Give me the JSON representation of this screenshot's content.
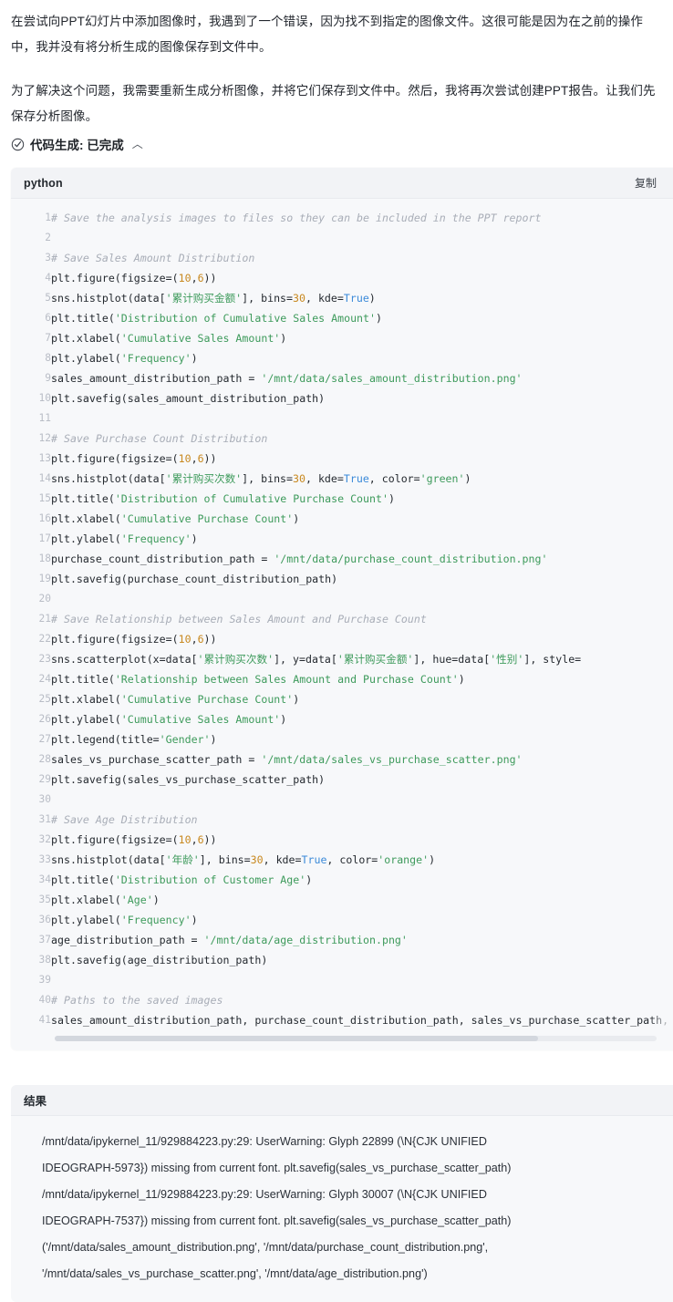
{
  "prose": {
    "paragraph1": "在尝试向PPT幻灯片中添加图像时，我遇到了一个错误，因为找不到指定的图像文件。这很可能是因为在之前的操作中，我并没有将分析生成的图像保存到文件中。",
    "paragraph2": "为了解决这个问题，我需要重新生成分析图像，并将它们保存到文件中。然后，我将再次尝试创建PPT报告。让我们先保存分析图像。"
  },
  "tool_status": {
    "icon": "check-circle-icon",
    "label": "代码生成: 已完成",
    "caret": "︿"
  },
  "code_block": {
    "language": "python",
    "copy_label": "复制",
    "lines": [
      {
        "n": "1",
        "tokens": [
          {
            "t": "com",
            "s": "# Save the analysis images to files so they can be included in the PPT report"
          }
        ]
      },
      {
        "n": "2",
        "tokens": []
      },
      {
        "n": "3",
        "tokens": [
          {
            "t": "com",
            "s": "# Save Sales Amount Distribution"
          }
        ]
      },
      {
        "n": "4",
        "tokens": [
          {
            "t": "pln",
            "s": "plt.figure(figsize=("
          },
          {
            "t": "num",
            "s": "10"
          },
          {
            "t": "pln",
            "s": ","
          },
          {
            "t": "num",
            "s": "6"
          },
          {
            "t": "pln",
            "s": "))"
          }
        ]
      },
      {
        "n": "5",
        "tokens": [
          {
            "t": "pln",
            "s": "sns.histplot(data["
          },
          {
            "t": "str",
            "s": "'累计购买金额'"
          },
          {
            "t": "pln",
            "s": "], bins="
          },
          {
            "t": "num",
            "s": "30"
          },
          {
            "t": "pln",
            "s": ", kde="
          },
          {
            "t": "kw",
            "s": "True"
          },
          {
            "t": "pln",
            "s": ")"
          }
        ]
      },
      {
        "n": "6",
        "tokens": [
          {
            "t": "pln",
            "s": "plt.title("
          },
          {
            "t": "str",
            "s": "'Distribution of Cumulative Sales Amount'"
          },
          {
            "t": "pln",
            "s": ")"
          }
        ]
      },
      {
        "n": "7",
        "tokens": [
          {
            "t": "pln",
            "s": "plt.xlabel("
          },
          {
            "t": "str",
            "s": "'Cumulative Sales Amount'"
          },
          {
            "t": "pln",
            "s": ")"
          }
        ]
      },
      {
        "n": "8",
        "tokens": [
          {
            "t": "pln",
            "s": "plt.ylabel("
          },
          {
            "t": "str",
            "s": "'Frequency'"
          },
          {
            "t": "pln",
            "s": ")"
          }
        ]
      },
      {
        "n": "9",
        "tokens": [
          {
            "t": "pln",
            "s": "sales_amount_distribution_path = "
          },
          {
            "t": "str",
            "s": "'/mnt/data/sales_amount_distribution.png'"
          }
        ]
      },
      {
        "n": "10",
        "tokens": [
          {
            "t": "pln",
            "s": "plt.savefig(sales_amount_distribution_path)"
          }
        ]
      },
      {
        "n": "11",
        "tokens": []
      },
      {
        "n": "12",
        "tokens": [
          {
            "t": "com",
            "s": "# Save Purchase Count Distribution"
          }
        ]
      },
      {
        "n": "13",
        "tokens": [
          {
            "t": "pln",
            "s": "plt.figure(figsize=("
          },
          {
            "t": "num",
            "s": "10"
          },
          {
            "t": "pln",
            "s": ","
          },
          {
            "t": "num",
            "s": "6"
          },
          {
            "t": "pln",
            "s": "))"
          }
        ]
      },
      {
        "n": "14",
        "tokens": [
          {
            "t": "pln",
            "s": "sns.histplot(data["
          },
          {
            "t": "str",
            "s": "'累计购买次数'"
          },
          {
            "t": "pln",
            "s": "], bins="
          },
          {
            "t": "num",
            "s": "30"
          },
          {
            "t": "pln",
            "s": ", kde="
          },
          {
            "t": "kw",
            "s": "True"
          },
          {
            "t": "pln",
            "s": ", color="
          },
          {
            "t": "str",
            "s": "'green'"
          },
          {
            "t": "pln",
            "s": ")"
          }
        ]
      },
      {
        "n": "15",
        "tokens": [
          {
            "t": "pln",
            "s": "plt.title("
          },
          {
            "t": "str",
            "s": "'Distribution of Cumulative Purchase Count'"
          },
          {
            "t": "pln",
            "s": ")"
          }
        ]
      },
      {
        "n": "16",
        "tokens": [
          {
            "t": "pln",
            "s": "plt.xlabel("
          },
          {
            "t": "str",
            "s": "'Cumulative Purchase Count'"
          },
          {
            "t": "pln",
            "s": ")"
          }
        ]
      },
      {
        "n": "17",
        "tokens": [
          {
            "t": "pln",
            "s": "plt.ylabel("
          },
          {
            "t": "str",
            "s": "'Frequency'"
          },
          {
            "t": "pln",
            "s": ")"
          }
        ]
      },
      {
        "n": "18",
        "tokens": [
          {
            "t": "pln",
            "s": "purchase_count_distribution_path = "
          },
          {
            "t": "str",
            "s": "'/mnt/data/purchase_count_distribution.png'"
          }
        ]
      },
      {
        "n": "19",
        "tokens": [
          {
            "t": "pln",
            "s": "plt.savefig(purchase_count_distribution_path)"
          }
        ]
      },
      {
        "n": "20",
        "tokens": []
      },
      {
        "n": "21",
        "tokens": [
          {
            "t": "com",
            "s": "# Save Relationship between Sales Amount and Purchase Count"
          }
        ]
      },
      {
        "n": "22",
        "tokens": [
          {
            "t": "pln",
            "s": "plt.figure(figsize=("
          },
          {
            "t": "num",
            "s": "10"
          },
          {
            "t": "pln",
            "s": ","
          },
          {
            "t": "num",
            "s": "6"
          },
          {
            "t": "pln",
            "s": "))"
          }
        ]
      },
      {
        "n": "23",
        "tokens": [
          {
            "t": "pln",
            "s": "sns.scatterplot(x=data["
          },
          {
            "t": "str",
            "s": "'累计购买次数'"
          },
          {
            "t": "pln",
            "s": "], y=data["
          },
          {
            "t": "str",
            "s": "'累计购买金额'"
          },
          {
            "t": "pln",
            "s": "], hue=data["
          },
          {
            "t": "str",
            "s": "'性别'"
          },
          {
            "t": "pln",
            "s": "], style="
          }
        ]
      },
      {
        "n": "24",
        "tokens": [
          {
            "t": "pln",
            "s": "plt.title("
          },
          {
            "t": "str",
            "s": "'Relationship between Sales Amount and Purchase Count'"
          },
          {
            "t": "pln",
            "s": ")"
          }
        ]
      },
      {
        "n": "25",
        "tokens": [
          {
            "t": "pln",
            "s": "plt.xlabel("
          },
          {
            "t": "str",
            "s": "'Cumulative Purchase Count'"
          },
          {
            "t": "pln",
            "s": ")"
          }
        ]
      },
      {
        "n": "26",
        "tokens": [
          {
            "t": "pln",
            "s": "plt.ylabel("
          },
          {
            "t": "str",
            "s": "'Cumulative Sales Amount'"
          },
          {
            "t": "pln",
            "s": ")"
          }
        ]
      },
      {
        "n": "27",
        "tokens": [
          {
            "t": "pln",
            "s": "plt.legend(title="
          },
          {
            "t": "str",
            "s": "'Gender'"
          },
          {
            "t": "pln",
            "s": ")"
          }
        ]
      },
      {
        "n": "28",
        "tokens": [
          {
            "t": "pln",
            "s": "sales_vs_purchase_scatter_path = "
          },
          {
            "t": "str",
            "s": "'/mnt/data/sales_vs_purchase_scatter.png'"
          }
        ]
      },
      {
        "n": "29",
        "tokens": [
          {
            "t": "pln",
            "s": "plt.savefig(sales_vs_purchase_scatter_path)"
          }
        ]
      },
      {
        "n": "30",
        "tokens": []
      },
      {
        "n": "31",
        "tokens": [
          {
            "t": "com",
            "s": "# Save Age Distribution"
          }
        ]
      },
      {
        "n": "32",
        "tokens": [
          {
            "t": "pln",
            "s": "plt.figure(figsize=("
          },
          {
            "t": "num",
            "s": "10"
          },
          {
            "t": "pln",
            "s": ","
          },
          {
            "t": "num",
            "s": "6"
          },
          {
            "t": "pln",
            "s": "))"
          }
        ]
      },
      {
        "n": "33",
        "tokens": [
          {
            "t": "pln",
            "s": "sns.histplot(data["
          },
          {
            "t": "str",
            "s": "'年龄'"
          },
          {
            "t": "pln",
            "s": "], bins="
          },
          {
            "t": "num",
            "s": "30"
          },
          {
            "t": "pln",
            "s": ", kde="
          },
          {
            "t": "kw",
            "s": "True"
          },
          {
            "t": "pln",
            "s": ", color="
          },
          {
            "t": "str",
            "s": "'orange'"
          },
          {
            "t": "pln",
            "s": ")"
          }
        ]
      },
      {
        "n": "34",
        "tokens": [
          {
            "t": "pln",
            "s": "plt.title("
          },
          {
            "t": "str",
            "s": "'Distribution of Customer Age'"
          },
          {
            "t": "pln",
            "s": ")"
          }
        ]
      },
      {
        "n": "35",
        "tokens": [
          {
            "t": "pln",
            "s": "plt.xlabel("
          },
          {
            "t": "str",
            "s": "'Age'"
          },
          {
            "t": "pln",
            "s": ")"
          }
        ]
      },
      {
        "n": "36",
        "tokens": [
          {
            "t": "pln",
            "s": "plt.ylabel("
          },
          {
            "t": "str",
            "s": "'Frequency'"
          },
          {
            "t": "pln",
            "s": ")"
          }
        ]
      },
      {
        "n": "37",
        "tokens": [
          {
            "t": "pln",
            "s": "age_distribution_path = "
          },
          {
            "t": "str",
            "s": "'/mnt/data/age_distribution.png'"
          }
        ]
      },
      {
        "n": "38",
        "tokens": [
          {
            "t": "pln",
            "s": "plt.savefig(age_distribution_path)"
          }
        ]
      },
      {
        "n": "39",
        "tokens": []
      },
      {
        "n": "40",
        "tokens": [
          {
            "t": "com",
            "s": "# Paths to the saved images"
          }
        ]
      },
      {
        "n": "41",
        "tokens": [
          {
            "t": "pln",
            "s": "sales_amount_distribution_path, purchase_count_distribution_path, sales_vs_purchase_scatter_path, age_distribution_path"
          }
        ]
      }
    ]
  },
  "result_block": {
    "title": "结果",
    "lines": [
      "/mnt/data/ipykernel_11/929884223.py:29: UserWarning: Glyph 22899 (\\N{CJK UNIFIED",
      "IDEOGRAPH-5973}) missing from current font. plt.savefig(sales_vs_purchase_scatter_path)",
      "/mnt/data/ipykernel_11/929884223.py:29: UserWarning: Glyph 30007 (\\N{CJK UNIFIED",
      "IDEOGRAPH-7537}) missing from current font. plt.savefig(sales_vs_purchase_scatter_path)",
      "('/mnt/data/sales_amount_distribution.png', '/mnt/data/purchase_count_distribution.png',",
      "'/mnt/data/sales_vs_purchase_scatter.png', '/mnt/data/age_distribution.png')"
    ]
  },
  "colors": {
    "code_bg": "#f7f8fa",
    "code_header_bg": "#f2f3f6",
    "string": "#3d9a5b",
    "number": "#c8881f",
    "keyword": "#3b8ad9",
    "comment": "#a8adb7",
    "text": "#24292f"
  }
}
